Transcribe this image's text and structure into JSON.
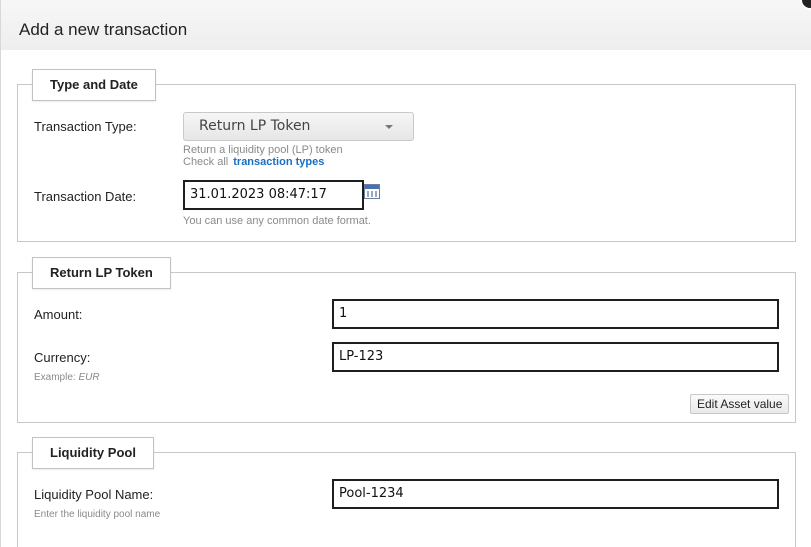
{
  "dialog": {
    "title": "Add a new transaction"
  },
  "type_date": {
    "legend": "Type and Date",
    "type_label": "Transaction Type:",
    "type_value": "Return LP Token",
    "type_hint": "Return a liquidity pool (LP) token",
    "check_all_text": "Check all",
    "types_link": "transaction types",
    "date_label": "Transaction Date:",
    "date_value": "31.01.2023 08:47:17",
    "date_hint": "You can use any common date format."
  },
  "return_lp": {
    "legend": "Return LP Token",
    "amount_label": "Amount:",
    "amount_value": "1",
    "currency_label": "Currency:",
    "currency_value": "LP-123",
    "currency_hint_prefix": "Example:",
    "currency_hint_example": "EUR",
    "edit_button": "Edit Asset value"
  },
  "pool": {
    "legend": "Liquidity Pool",
    "name_label": "Liquidity Pool Name:",
    "name_value": "Pool-1234",
    "name_hint": "Enter the liquidity pool name"
  }
}
